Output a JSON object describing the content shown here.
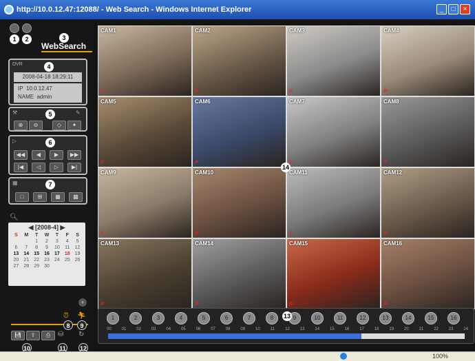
{
  "window": {
    "title": "http://10.0.12.47:12088/ - Web Search - Windows Internet Explorer"
  },
  "app": {
    "title": "WebSearch"
  },
  "dvr": {
    "label": "DVR",
    "datetime": "2008-04-18 18:29:11",
    "ip_label": "IP",
    "ip": "10.0.12.47",
    "user_label": "NAME",
    "user": "admin"
  },
  "callouts": [
    "1",
    "2",
    "3",
    "4",
    "5",
    "6",
    "7",
    "8",
    "9",
    "10",
    "11",
    "12",
    "13",
    "14"
  ],
  "calendar": {
    "title": "[2008-4]",
    "prev": "◀",
    "next": "▶",
    "weekdays": [
      "S",
      "M",
      "T",
      "W",
      "T",
      "F",
      "S"
    ],
    "days": [
      "",
      "",
      "1",
      "2",
      "3",
      "4",
      "5",
      "6",
      "7",
      "8",
      "9",
      "10",
      "11",
      "12",
      "13",
      "14",
      "15",
      "16",
      "17",
      "18",
      "19",
      "20",
      "21",
      "22",
      "23",
      "24",
      "25",
      "26",
      "27",
      "28",
      "29",
      "30",
      "",
      "",
      ""
    ],
    "highlight_color": "#e02020"
  },
  "cameras": [
    "CAM1",
    "CAM2",
    "CAM3",
    "CAM4",
    "CAM5",
    "CAM6",
    "CAM7",
    "CAM8",
    "CAM9",
    "CAM10",
    "CAM11",
    "CAM12",
    "CAM13",
    "CAM14",
    "CAM15",
    "CAM16"
  ],
  "timeline": {
    "channels": [
      "1",
      "2",
      "3",
      "4",
      "5",
      "6",
      "7",
      "8",
      "9",
      "10",
      "11",
      "12",
      "13",
      "14",
      "15",
      "16"
    ],
    "hours": [
      "00",
      "01",
      "02",
      "03",
      "04",
      "05",
      "06",
      "07",
      "08",
      "09",
      "10",
      "11",
      "12",
      "13",
      "14",
      "15",
      "16",
      "17",
      "18",
      "19",
      "20",
      "21",
      "22",
      "23",
      "24"
    ],
    "progress": 0.71
  },
  "status": {
    "zoom": "100%"
  },
  "colors": {
    "accent": "#e8a000",
    "timeline_fill": "#3a6fd8"
  }
}
